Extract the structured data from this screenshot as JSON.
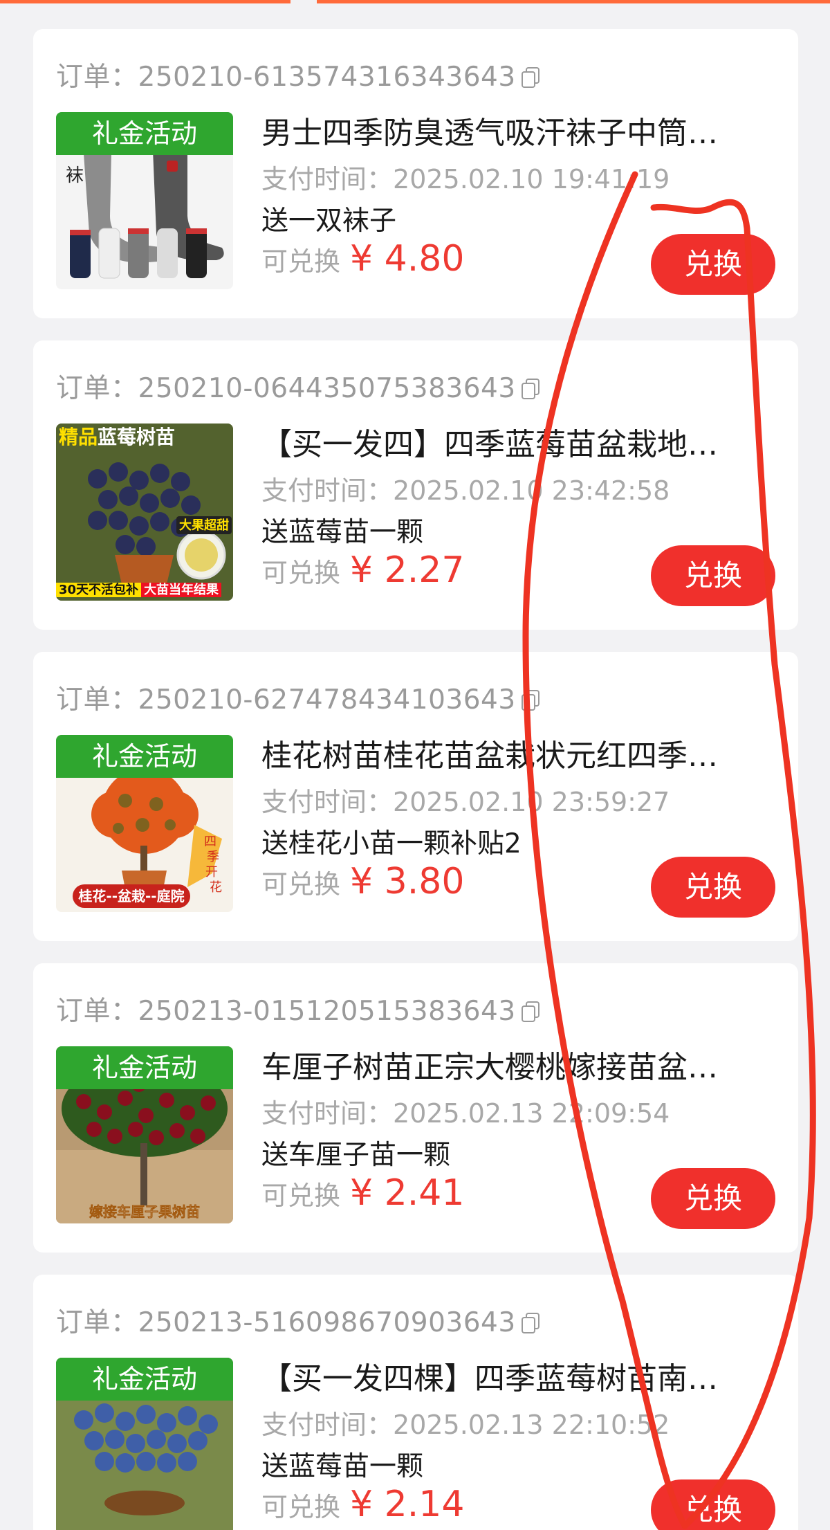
{
  "colors": {
    "accent": "#ff6a3a",
    "price": "#ee3a32",
    "button": "#f0302c",
    "badge_green": "#2fa62f",
    "annotation": "#ee3322"
  },
  "labels": {
    "order_prefix": "订单：",
    "pay_time_prefix": "支付时间：",
    "price_prefix": "可兑换",
    "button": "兑换",
    "currency": "¥"
  },
  "orders": [
    {
      "order_no": "250210-613574316343643",
      "badge": "礼金活动",
      "title": "男士四季防臭透气吸汗袜子中筒…",
      "pay_time": "2025.02.10 19:41:19",
      "gift": "送一双袜子",
      "price": "¥ 4.80",
      "image": "socks-product-image"
    },
    {
      "order_no": "250210-064435075383643",
      "badge_left": "精品",
      "badge_right": "蓝莓树苗",
      "badge_extra": "大果超甜",
      "bottom_tag_left": "30天不活包补",
      "bottom_tag_right": "大苗当年结果",
      "title": "【买一发四】四季蓝莓苗盆栽地…",
      "pay_time": "2025.02.10 23:42:58",
      "gift": "送蓝莓苗一颗",
      "price": "¥ 2.27",
      "image": "blueberry-seedling-image"
    },
    {
      "order_no": "250210-627478434103643",
      "badge": "礼金活动",
      "bottom_tag": "桂花--盆栽--庭院",
      "side_tag": "四季开花",
      "title": "桂花树苗桂花苗盆栽状元红四季…",
      "pay_time": "2025.02.10 23:59:27",
      "gift": "送桂花小苗一颗补贴2",
      "price": "¥ 3.80",
      "image": "osmanthus-tree-image"
    },
    {
      "order_no": "250213-015120515383643",
      "badge": "礼金活动",
      "bottom_tag": "嫁接车厘子果树苗",
      "title": "车厘子树苗正宗大樱桃嫁接苗盆…",
      "pay_time": "2025.02.13 22:09:54",
      "gift": "送车厘子苗一颗",
      "price": "¥ 2.41",
      "image": "cherry-tree-image"
    },
    {
      "order_no": "250213-516098670903643",
      "badge": "礼金活动",
      "title": "【买一发四棵】四季蓝莓树苗南…",
      "pay_time": "2025.02.13 22:10:52",
      "gift": "送蓝莓苗一颗",
      "price": "¥ 2.14",
      "image": "blueberry-pot-image"
    }
  ]
}
